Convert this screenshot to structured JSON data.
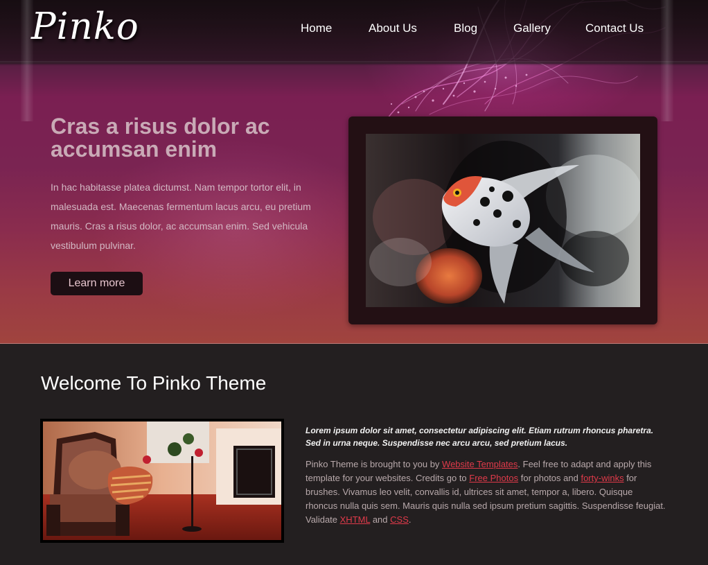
{
  "site": {
    "logo": "Pinko"
  },
  "nav": {
    "items": [
      {
        "label": "Home"
      },
      {
        "label": "About Us"
      },
      {
        "label": "Blog"
      },
      {
        "label": "Gallery"
      },
      {
        "label": "Contact Us"
      }
    ]
  },
  "hero": {
    "title_line1": "Cras a risus dolor ac",
    "title_line2": "accumsan enim",
    "text": "In hac habitasse platea dictumst. Nam tempor tortor elit, in malesuada est. Maecenas fermentum lacus arcu, eu pretium mauris. Cras a risus dolor, ac accumsan enim. Sed vehicula vestibulum pulvinar.",
    "button_label": "Learn more"
  },
  "main": {
    "heading": "Welcome To Pinko Theme",
    "lead": "Lorem ipsum dolor sit amet, consectetur adipiscing elit. Etiam rutrum rhoncus pharetra. Sed in urna neque. Suspendisse nec arcu arcu, sed pretium lacus.",
    "body": {
      "t1": "Pinko Theme is brought to you by ",
      "link1": "Website Templates",
      "t2": ". Feel free to adapt and apply this template for your websites. Credits go to ",
      "link2": "Free Photos",
      "t3": " for photos and ",
      "link3": "forty-winks",
      "t4": " for brushes. Vivamus leo velit, convallis id, ultrices sit amet, tempor a, libero. Quisque rhoncus nulla quis sem. Mauris quis nulla sed ipsum pretium sagittis. Suspendisse feugiat. Validate ",
      "link4": "XHTML",
      "t5": " and ",
      "link5": "CSS",
      "t6": "."
    }
  },
  "colors": {
    "page_background": "#231f20",
    "hero_pink": "#7a1f52",
    "hero_title": "#c9aab6",
    "link": "#e03a4a",
    "button_bg": "#1c0e13"
  }
}
